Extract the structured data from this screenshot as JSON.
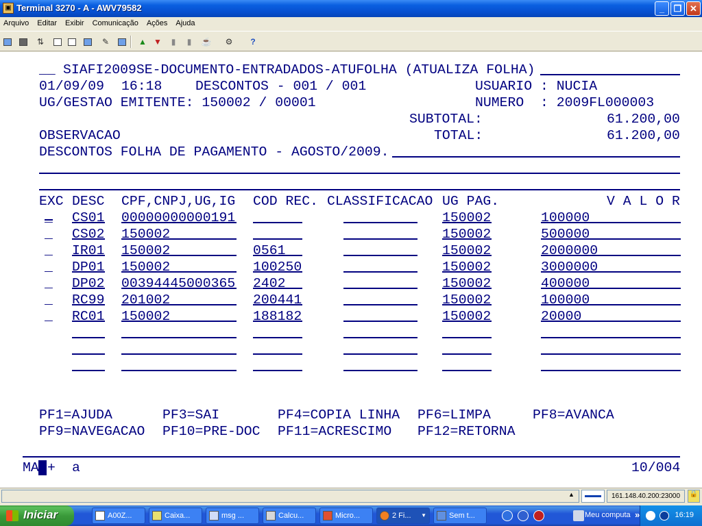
{
  "window": {
    "title": "Terminal 3270 - A - AWV79582",
    "minimize": "_",
    "maximize": "❐",
    "close": "✕"
  },
  "menu": [
    "Arquivo",
    "Editar",
    "Exibir",
    "Comunicação",
    "Ações",
    "Ajuda"
  ],
  "toolbar_icons": [
    "print-screen-icon",
    "print-setup-icon",
    "receive-file-icon",
    "copy-icon",
    "paste-icon",
    "copy-append-icon",
    "macro-icon",
    "keypad-icon",
    "send-icon",
    "receive-icon",
    "disconnect-icon",
    "connect-icon",
    "clipboard-icon",
    "settings-icon",
    "help-icon"
  ],
  "screen": {
    "header": {
      "prefix": "__",
      "title": "SIAFI2009SE-DOCUMENTO-ENTRADADOS-ATUFOLHA (ATUALIZA FOLHA)",
      "date": "01/09/09",
      "time": "16:18",
      "descontos": "DESCONTOS - 001 / 001",
      "usuario": "USUARIO : NUCIA",
      "ug_gestao": "UG/GESTAO EMITENTE: 150002 / 00001",
      "numero": "NUMERO  : 2009FL000003",
      "subtotal_label": "SUBTOTAL:",
      "subtotal": "61.200,00",
      "observacao_label": "OBSERVACAO",
      "total_label": "TOTAL:",
      "total": "61.200,00",
      "observacao_text": "DESCONTOS FOLHA DE PAGAMENTO - AGOSTO/2009."
    },
    "columns": {
      "exc": "EXC",
      "desc": "DESC",
      "doc": "CPF,CNPJ,UG,IG",
      "cod_rec": "COD REC.",
      "classificacao": "CLASSIFICACAO",
      "ug_pag": "UG PAG.",
      "valor": "V A L O R"
    },
    "rows": [
      {
        "exc": "_",
        "desc": "CS01",
        "doc": "00000000000191",
        "cod_rec": "",
        "classificacao": "",
        "ug_pag": "150002",
        "valor": "100000"
      },
      {
        "exc": "_",
        "desc": "CS02",
        "doc": "150002",
        "cod_rec": "",
        "classificacao": "",
        "ug_pag": "150002",
        "valor": "500000"
      },
      {
        "exc": "_",
        "desc": "IR01",
        "doc": "150002",
        "cod_rec": "0561",
        "classificacao": "",
        "ug_pag": "150002",
        "valor": "2000000"
      },
      {
        "exc": "_",
        "desc": "DP01",
        "doc": "150002",
        "cod_rec": "100250",
        "classificacao": "",
        "ug_pag": "150002",
        "valor": "3000000"
      },
      {
        "exc": "_",
        "desc": "DP02",
        "doc": "00394445000365",
        "cod_rec": "2402",
        "classificacao": "",
        "ug_pag": "150002",
        "valor": "400000"
      },
      {
        "exc": "_",
        "desc": "RC99",
        "doc": "201002",
        "cod_rec": "200441",
        "classificacao": "",
        "ug_pag": "150002",
        "valor": "100000"
      },
      {
        "exc": "_",
        "desc": "RC01",
        "doc": "150002",
        "cod_rec": "188182",
        "classificacao": "",
        "ug_pag": "150002",
        "valor": "20000"
      },
      {
        "exc": "",
        "desc": "",
        "doc": "",
        "cod_rec": "",
        "classificacao": "",
        "ug_pag": "",
        "valor": ""
      },
      {
        "exc": "",
        "desc": "",
        "doc": "",
        "cod_rec": "",
        "classificacao": "",
        "ug_pag": "",
        "valor": ""
      },
      {
        "exc": "",
        "desc": "",
        "doc": "",
        "cod_rec": "",
        "classificacao": "",
        "ug_pag": "",
        "valor": ""
      }
    ],
    "pf_keys": {
      "pf1": "PF1=AJUDA",
      "pf3": "PF3=SAI",
      "pf4": "PF4=COPIA LINHA",
      "pf6": "PF6=LIMPA",
      "pf8": "PF8=AVANCA",
      "pf9": "PF9=NAVEGACAO",
      "pf10": "PF10=PRE-DOC",
      "pf11": "PF11=ACRESCIMO",
      "pf12": "PF12=RETORNA"
    },
    "oia": {
      "ma": "MA",
      "plus": "+",
      "mode": "a",
      "position": "10/004"
    }
  },
  "statusbar": {
    "up_arrow": "▲",
    "host": "161.148.40.200:23000"
  },
  "taskbar": {
    "start": "Iniciar",
    "tasks": [
      {
        "label": "A00Z..."
      },
      {
        "label": "Caixa..."
      },
      {
        "label": "msg ..."
      },
      {
        "label": "Calcu..."
      },
      {
        "label": "Micro..."
      },
      {
        "label": "2 Fi..."
      },
      {
        "label": "Sem t..."
      }
    ],
    "explorer": "Meu computa",
    "chevron": "»",
    "clock": "16:19"
  }
}
